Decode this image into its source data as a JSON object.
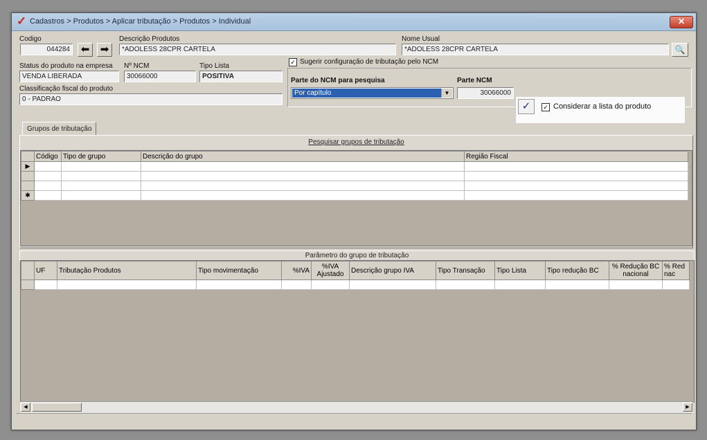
{
  "window": {
    "title": "Cadastros > Produtos > Aplicar tributação > Produtos > Individual",
    "close_label": "✕"
  },
  "form": {
    "codigo_label": "Codigo",
    "codigo_value": "044284",
    "descricao_label": "Descrição Produtos",
    "descricao_value": "*ADOLESS 28CPR CARTELA",
    "nome_usual_label": "Nome Usual",
    "nome_usual_value": "*ADOLESS 28CPR CARTELA",
    "status_label": "Status do produto na empresa",
    "status_value": "VENDA LIBERADA",
    "ncm_label": "Nº NCM",
    "ncm_value": "30066000",
    "tipo_lista_label": "Tipo Lista",
    "tipo_lista_value": "POSITIVA",
    "classificacao_label": "Classificação fiscal do produto",
    "classificacao_value": "0 - PADRAO",
    "sugerir_label": "Sugerir configuração de tributação pelo NCM",
    "parte_ncm_pesquisa_label": "Parte do NCM para pesquisa",
    "parte_ncm_pesquisa_value": "Por capítulo",
    "parte_ncm_label": "Parte NCM",
    "parte_ncm_value": "30066000",
    "considerar_label": "Considerar a lista do produto"
  },
  "tabs": [
    {
      "label": "Grupos de tributação"
    }
  ],
  "grupos_panel": {
    "title": "Pesquisar grupos de tributação",
    "columns": [
      "Código",
      "Tipo de grupo",
      "Descrição do grupo",
      "Região Fiscal"
    ],
    "row_indicators": [
      "▶",
      "",
      "",
      "✱"
    ]
  },
  "parametro_panel": {
    "title": "Parâmetro do grupo de tributação",
    "columns": [
      "UF",
      "Tributação Produtos",
      "Tipo movimentação",
      "%IVA",
      "%IVA Ajustado",
      "Descrição grupo IVA",
      "Tipo Transação",
      "Tipo Lista",
      "Tipo redução BC",
      "% Redução BC nacional",
      "% Red nac"
    ]
  },
  "icons": {
    "app": "app-logo-icon",
    "prev": "arrow-left-icon",
    "next": "arrow-right-icon",
    "search": "search-icon",
    "confirm": "checkmark-icon"
  }
}
